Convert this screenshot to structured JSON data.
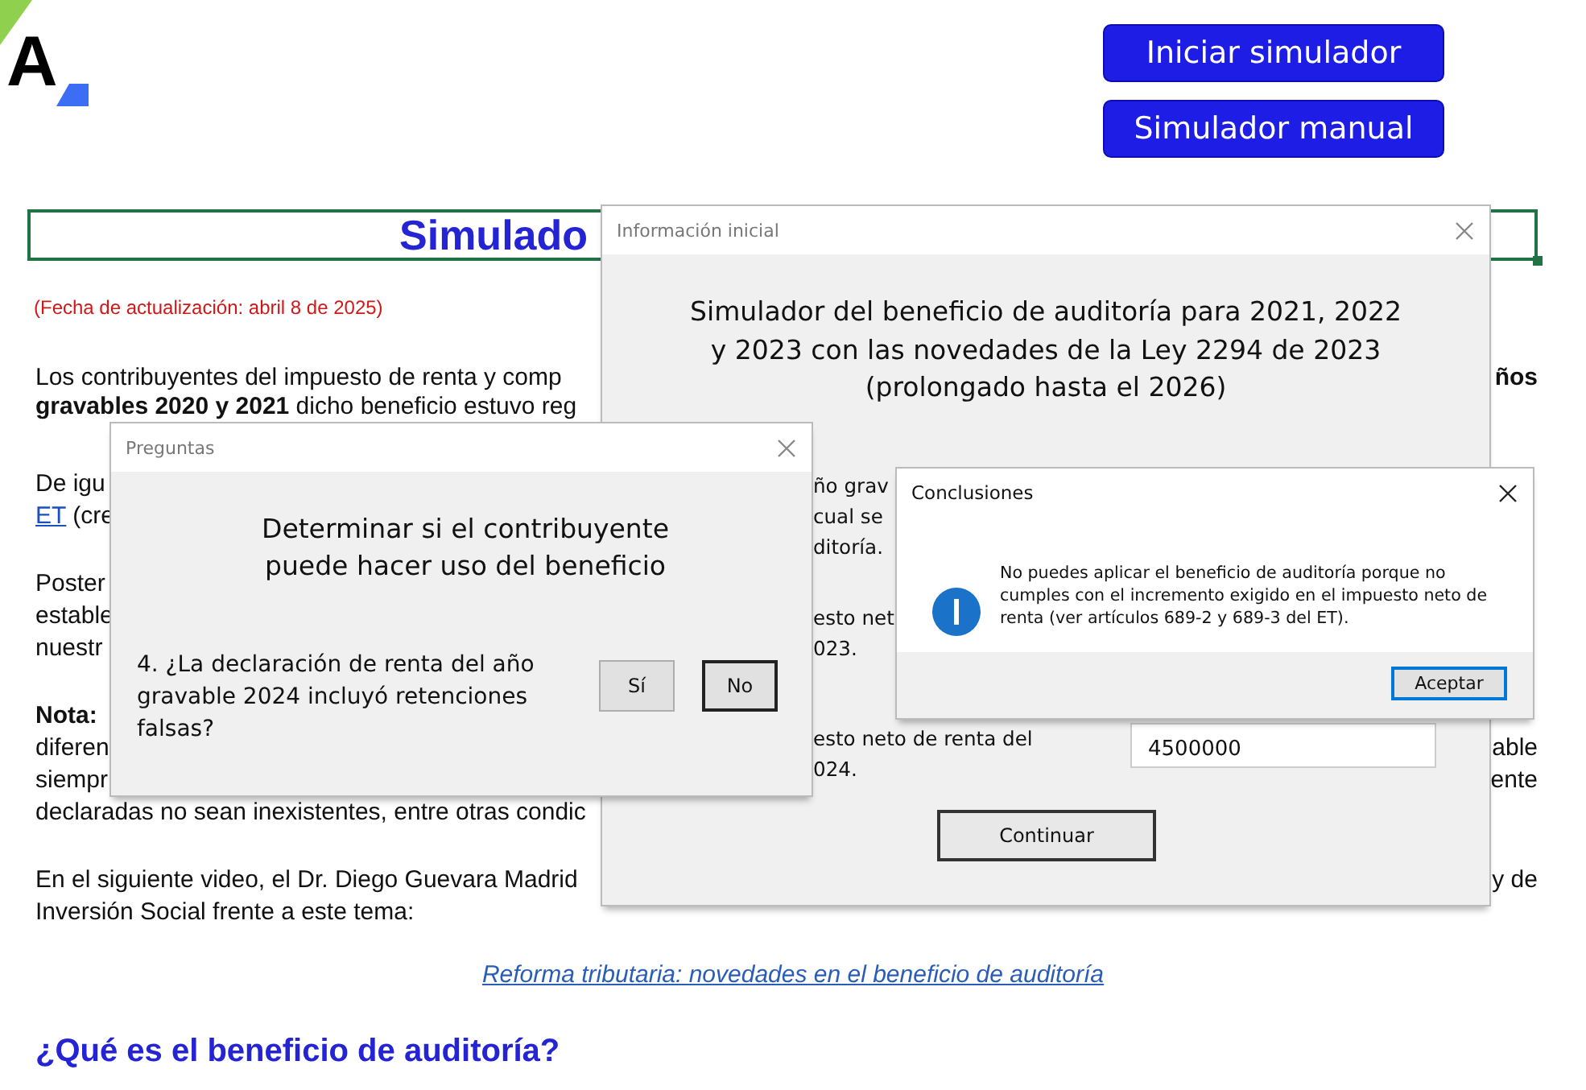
{
  "header": {
    "logo_text": "A",
    "buttons": [
      {
        "label": "Iniciar simulador"
      },
      {
        "label": "Simulador manual"
      }
    ]
  },
  "title": "Simulado",
  "updated": "(Fecha de actualización: abril 8 de 2025)",
  "article": {
    "paragraphs": [
      {
        "lines": [
          {
            "left": "Los contribuyentes del impuesto de renta y comp",
            "right": "**ños**"
          },
          {
            "left": "**gravables 2020 y 2021** dicho beneficio estuvo reg"
          }
        ]
      },
      {
        "lines": [
          {
            "left": "De igu"
          },
          {
            "link": "ET",
            "left": "(cre"
          }
        ]
      },
      {
        "lines": [
          {
            "left": "Poster"
          },
          {
            "left": "estable"
          },
          {
            "left": "nuestr"
          }
        ]
      },
      {
        "lines": [
          {
            "left": "**Nota:**"
          },
          {
            "left": "diferen",
            "right": "able"
          },
          {
            "left": "siempr",
            "right": "ente"
          },
          {
            "left": "declaradas no sean inexistentes, entre otras condic"
          }
        ]
      },
      {
        "lines": [
          {
            "left": "En el siguiente video, el Dr. Diego Guevara Madrid",
            "right": "y de"
          },
          {
            "left": "Inversión Social frente a este tema:"
          }
        ]
      }
    ]
  },
  "video_link": "Reforma tributaria: novedades en el beneficio de auditoría",
  "section_heading": "¿Qué es el beneficio de auditoría?",
  "dialogs": [
    {
      "kind": "info",
      "title": "Información inicial",
      "heading": [
        "Simulador del beneficio de auditoría para 2021, 2022",
        "y 2023 con las novedades de la Ley 2294 de 2023",
        "(prolongado hasta el 2026)"
      ],
      "questions": [
        {
          "lines": [
            "ño grav",
            "cual se",
            "ditoría."
          ]
        },
        {
          "lines": [
            "esto net",
            "023."
          ]
        },
        {
          "lines": [
            "esto neto de renta del",
            "024."
          ],
          "value": "4500000"
        }
      ],
      "button": "Continuar"
    },
    {
      "kind": "question",
      "title": "Preguntas",
      "heading": [
        "Determinar si el contribuyente",
        "puede hacer uso del beneficio"
      ],
      "question": [
        "4. ¿La declaración de renta del año",
        "gravable 2024 incluyó retenciones",
        "falsas?"
      ],
      "buttons": [
        {
          "label": "Sí",
          "default": false
        },
        {
          "label": "No",
          "default": true
        }
      ]
    },
    {
      "kind": "message",
      "title": "Conclusiones",
      "message": [
        "No puedes aplicar el beneficio de auditoría porque no",
        "cumples con el incremento exigido en el impuesto neto de",
        "renta (ver artículos 689-2 y 689-3 del ET)."
      ],
      "button": {
        "label": "Aceptar",
        "focused": true
      }
    }
  ]
}
